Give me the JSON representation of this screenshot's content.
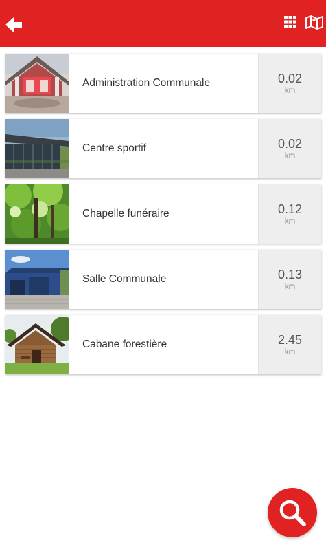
{
  "theme": {
    "accent": "#e02222"
  },
  "header": {
    "back_icon": "arrow-left-icon",
    "grid_icon": "grid-icon",
    "map_icon": "map-icon"
  },
  "places": [
    {
      "name": "Administration Communale",
      "distance": "0.02",
      "unit": "km"
    },
    {
      "name": "Centre sportif",
      "distance": "0.02",
      "unit": "km"
    },
    {
      "name": "Chapelle funéraire",
      "distance": "0.12",
      "unit": "km"
    },
    {
      "name": "Salle Communale",
      "distance": "0.13",
      "unit": "km"
    },
    {
      "name": "Cabane forestière",
      "distance": "2.45",
      "unit": "km"
    }
  ],
  "search_fab": {
    "icon": "search-icon"
  }
}
